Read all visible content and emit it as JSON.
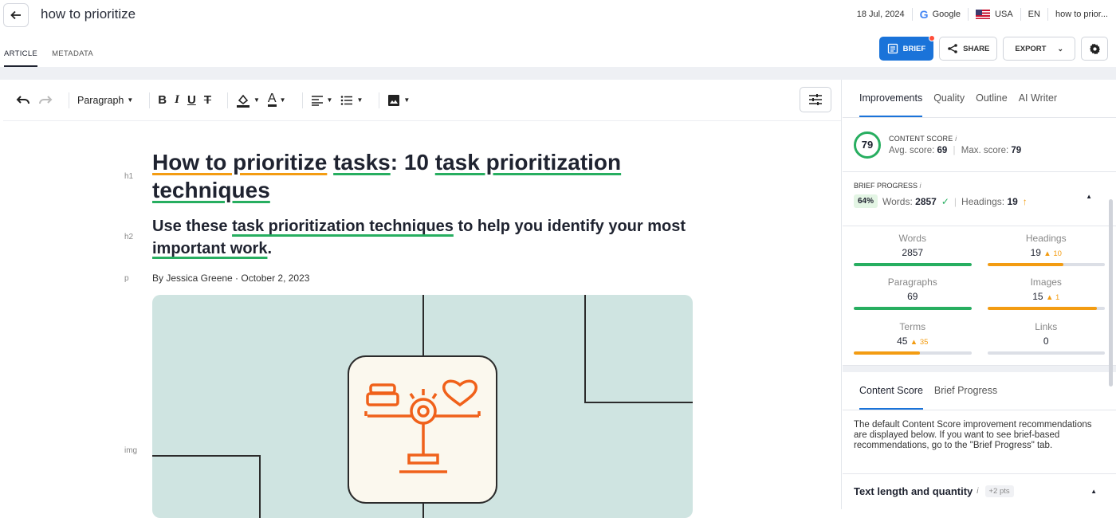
{
  "header": {
    "title": "how to prioritize",
    "date": "18 Jul, 2024",
    "engine": "Google",
    "country": "USA",
    "language": "EN",
    "keyword_short": "how to prior..."
  },
  "tabs": [
    "ARTICLE",
    "METADATA"
  ],
  "actions": {
    "brief": "BRIEF",
    "share": "SHARE",
    "export": "EXPORT"
  },
  "toolbar": {
    "paragraph": "Paragraph"
  },
  "article": {
    "h1_parts": [
      "How to prioritize",
      " ",
      "tasks",
      ": 10 ",
      "task prioritization",
      " ",
      "techniques"
    ],
    "h2_parts": [
      "Use these ",
      "task prioritization techniques",
      " to help you identify your most ",
      "important work",
      "."
    ],
    "byline": "By Jessica Greene · October 2, 2023",
    "gutter": {
      "h1": "h1",
      "h2": "h2",
      "p": "p",
      "img": "img"
    }
  },
  "panel": {
    "tabs": [
      "Improvements",
      "Quality",
      "Outline",
      "AI Writer"
    ],
    "content_score": {
      "label": "CONTENT SCORE",
      "value": "79",
      "avg_label": "Avg. score:",
      "avg": "69",
      "max_label": "Max. score:",
      "max": "79"
    },
    "brief_progress": {
      "label": "BRIEF PROGRESS",
      "percent": "64%",
      "words_label": "Words:",
      "words": "2857",
      "headings_label": "Headings:",
      "headings": "19"
    },
    "stats": [
      {
        "label": "Words",
        "value": "2857",
        "delta": "",
        "fill": 1.0,
        "color": "#27ae60"
      },
      {
        "label": "Headings",
        "value": "19",
        "delta": "▲ 10",
        "fill": 0.65,
        "color": "#f39c12"
      },
      {
        "label": "Paragraphs",
        "value": "69",
        "delta": "",
        "fill": 1.0,
        "color": "#27ae60"
      },
      {
        "label": "Images",
        "value": "15",
        "delta": "▲ 1",
        "fill": 0.93,
        "color": "#f39c12"
      },
      {
        "label": "Terms",
        "value": "45",
        "delta": "▲ 35",
        "fill": 0.56,
        "color": "#f39c12"
      },
      {
        "label": "Links",
        "value": "0",
        "delta": "",
        "fill": 0.0,
        "color": "#27ae60"
      }
    ],
    "content_tabs": [
      "Content Score",
      "Brief Progress"
    ],
    "description": "The default Content Score improvement recommendations are displayed below. If you want to see brief-based recommendations, go to the \"Brief Progress\" tab.",
    "section": {
      "title": "Text length and quantity",
      "pts": "+2 pts"
    }
  }
}
